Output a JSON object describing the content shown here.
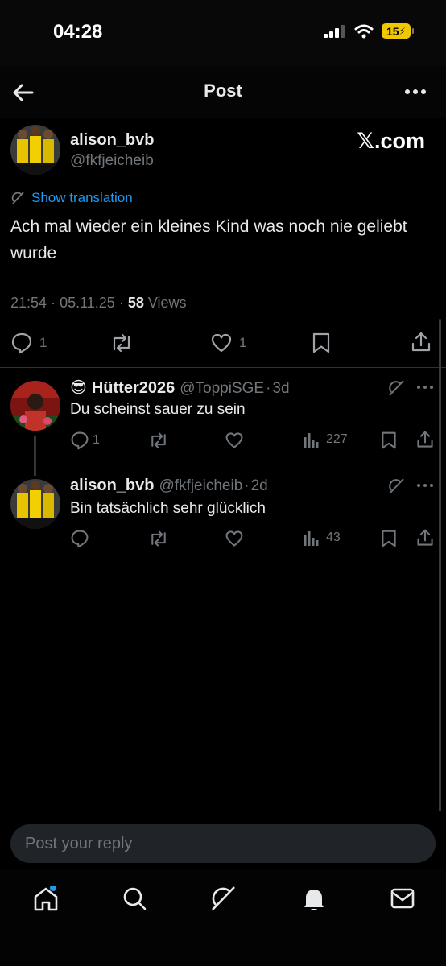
{
  "status_bar": {
    "time": "04:28",
    "battery": "15"
  },
  "header": {
    "title": "Post"
  },
  "post": {
    "author_name": "alison_bvb",
    "author_handle": "@fkfjeicheib",
    "watermark": "𝕏.com",
    "translate_label": "Show translation",
    "text": "Ach mal wieder ein kleines Kind was noch nie geliebt wurde",
    "time": "21:54",
    "date": "05.11.25",
    "views_count": "58",
    "views_label": "Views",
    "replies": "1",
    "likes": "1"
  },
  "replies": [
    {
      "emoji": "😎",
      "name": "Hütter2026",
      "handle": "@ToppiSGE",
      "age": "3d",
      "text": "Du scheinst sauer zu sein",
      "replies": "1",
      "views": "227"
    },
    {
      "name": "alison_bvb",
      "handle": "@fkfjeicheib",
      "age": "2d",
      "text": "Bin tatsächlich sehr glücklich",
      "views": "43"
    }
  ],
  "compose": {
    "placeholder": "Post your reply"
  },
  "icons": {
    "back": "arrow-left-icon",
    "more": "more-dots-icon",
    "translate": "grok-icon",
    "reply": "reply-icon",
    "repost": "repost-icon",
    "like": "heart-icon",
    "bookmark": "bookmark-icon",
    "share": "share-icon",
    "views": "views-chart-icon",
    "nav": [
      "home-icon",
      "search-icon",
      "grok-icon",
      "notifications-icon",
      "messages-icon"
    ]
  },
  "colors": {
    "accent": "#1d9bf0",
    "background": "#000000",
    "muted": "#71767b",
    "battery": "#f0c800"
  }
}
